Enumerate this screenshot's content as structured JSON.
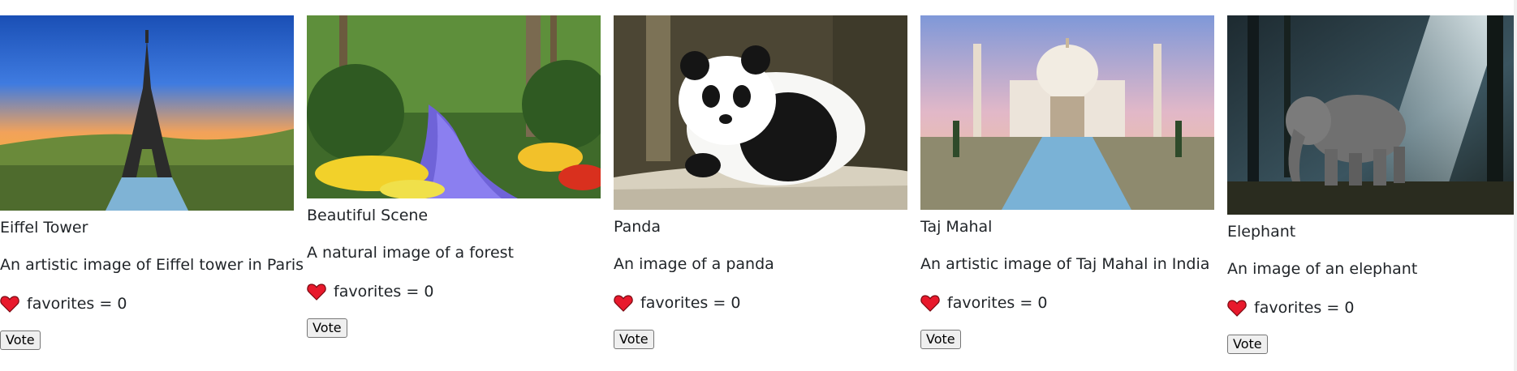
{
  "cards": [
    {
      "title": "Eiffel Tower",
      "description": "An artistic image of Eiffel tower in Paris",
      "favorites": "favorites = 0",
      "vote_label": "Vote"
    },
    {
      "title": "Beautiful Scene",
      "description": "A natural image of a forest",
      "favorites": "favorites = 0",
      "vote_label": "Vote"
    },
    {
      "title": "Panda",
      "description": "An image of a panda",
      "favorites": "favorites = 0",
      "vote_label": "Vote"
    },
    {
      "title": "Taj Mahal",
      "description": "An artistic image of Taj Mahal in India",
      "favorites": "favorites = 0",
      "vote_label": "Vote"
    },
    {
      "title": "Elephant",
      "description": "An image of an elephant",
      "favorites": "favorites = 0",
      "vote_label": "Vote"
    }
  ],
  "colors": {
    "heart": "#e8192c",
    "button_bg": "#efefef",
    "button_border": "#767676"
  },
  "icons": [
    "heart-icon"
  ]
}
